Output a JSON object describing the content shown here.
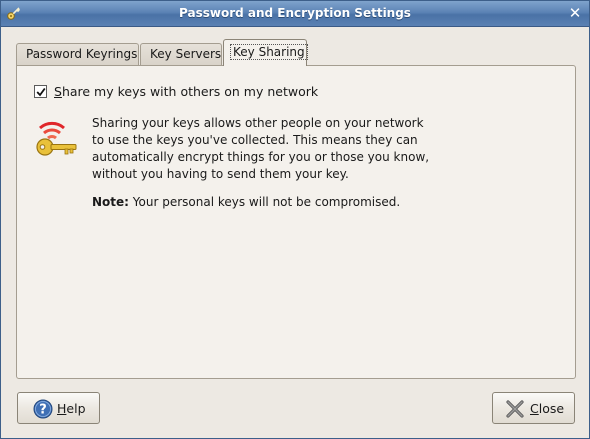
{
  "window": {
    "title": "Password and Encryption Settings",
    "app_icon": "key-icon",
    "close_icon": "close-icon"
  },
  "tabs": [
    {
      "label": "Password Keyrings",
      "active": false
    },
    {
      "label": "Key Servers",
      "active": false
    },
    {
      "label": "Key Sharing",
      "active": true
    }
  ],
  "sharing": {
    "checkbox_label_mnemonic": "S",
    "checkbox_label_rest": "hare my keys with others on my network",
    "checked": true,
    "description": "Sharing your keys allows other people on your network to use the keys you've collected. This means they can automatically encrypt things for you or those you know, without you having to send them your key.",
    "note_label": "Note:",
    "note_text": "Your personal keys will not be compromised.",
    "illustration_icon": "shared-key-icon"
  },
  "buttons": {
    "help_mnemonic": "H",
    "help_rest": "elp",
    "help_icon": "help-icon",
    "close_mnemonic": "C",
    "close_rest": "lose",
    "close_icon": "close-x-icon"
  }
}
